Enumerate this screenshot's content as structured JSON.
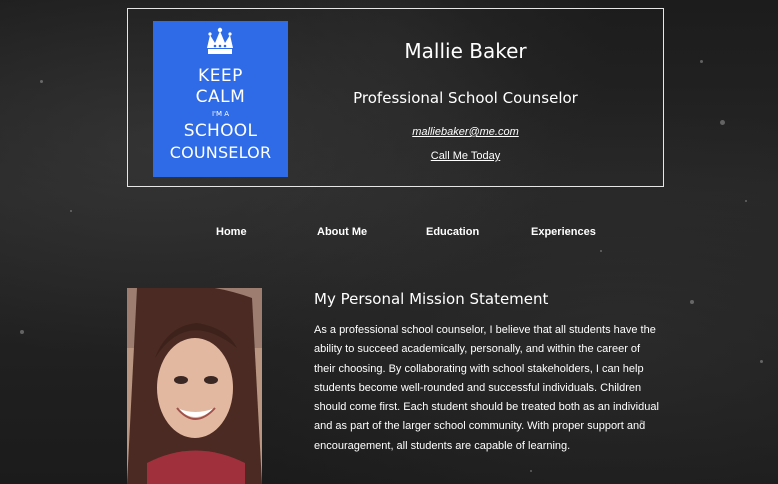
{
  "header": {
    "logo": {
      "line1": "KEEP",
      "line2": "CALM",
      "line3": "I'M A",
      "line4": "SCHOOL",
      "line5": "COUNSELOR",
      "background": "#2f6be6",
      "icon": "crown-icon"
    },
    "name": "Mallie Baker",
    "role": "Professional School Counselor",
    "email": "malliebaker@me.com",
    "call_label": "Call Me Today"
  },
  "nav": {
    "items": [
      "Home",
      "About Me",
      "Education",
      "Experiences"
    ]
  },
  "mission": {
    "title": "My Personal Mission Statement",
    "text": "As a professional school counselor, I believe that all students have the ability to succeed academically, personally, and within the career of their choosing. By collaborating with school stakeholders, I can help students become well-rounded and successful individuals. Children should come first. Each student should be treated both as an individual and as part of the larger school community. With proper support and encouragement, all students are capable of learning."
  },
  "colors": {
    "background": "#1a1a1a",
    "text": "#ffffff",
    "border": "#e6e6e6"
  }
}
